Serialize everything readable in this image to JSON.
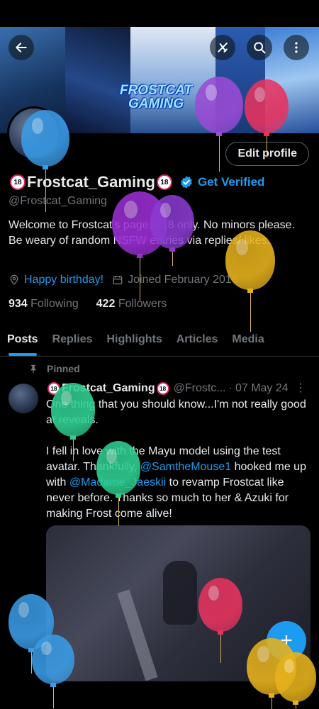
{
  "profile": {
    "display_name": "Frostcat_Gaming",
    "badge_text": "18",
    "handle": "@Frostcat_Gaming",
    "edit_profile_label": "Edit profile",
    "get_verified_label": "Get Verified",
    "bio": "Welcome to Frostcat's page. +18 only. No minors please. Be weary of random NSFW entries via replies/ likes.",
    "birthday_label": "Happy birthday!",
    "joined_label": "Joined February 2016",
    "following_count": "934",
    "following_label": "Following",
    "followers_count": "422",
    "followers_label": "Followers",
    "banner_logo_line1": "FROSTCAT",
    "banner_logo_line2": "GAMING"
  },
  "tabs": [
    {
      "label": "Posts",
      "active": true
    },
    {
      "label": "Replies"
    },
    {
      "label": "Highlights"
    },
    {
      "label": "Articles"
    },
    {
      "label": "Media"
    }
  ],
  "post": {
    "pinned_label": "Pinned",
    "author_name": "Frostcat_Gaming",
    "author_handle": "@Frostc...",
    "separator": "·",
    "date": "07 May 24",
    "more": "⋮",
    "para1": "One thing that you should know...I'm not really good at reveals.",
    "para2_a": "I fell in love with the Mayu model using the test avatar. Thankfully, ",
    "mention1": "@SamtheMouse1",
    "para2_b": " hooked me up with ",
    "mention2": "@Madame_Jaeskii",
    "para2_c": " to revamp Frostcat like never before. Thanks so much to her & Azuki for making Frost come alive!"
  },
  "fab_label": "+",
  "icons": {
    "back": "arrow-left-icon",
    "grok": "grok-icon",
    "search": "search-icon",
    "more": "more-vertical-icon",
    "verified": "verified-check-icon",
    "location": "location-icon",
    "calendar": "calendar-icon",
    "pin": "pin-icon"
  },
  "colors": {
    "accent": "#1d9bf0",
    "muted": "#71767b",
    "text": "#e7e9ea",
    "background": "#000000"
  }
}
